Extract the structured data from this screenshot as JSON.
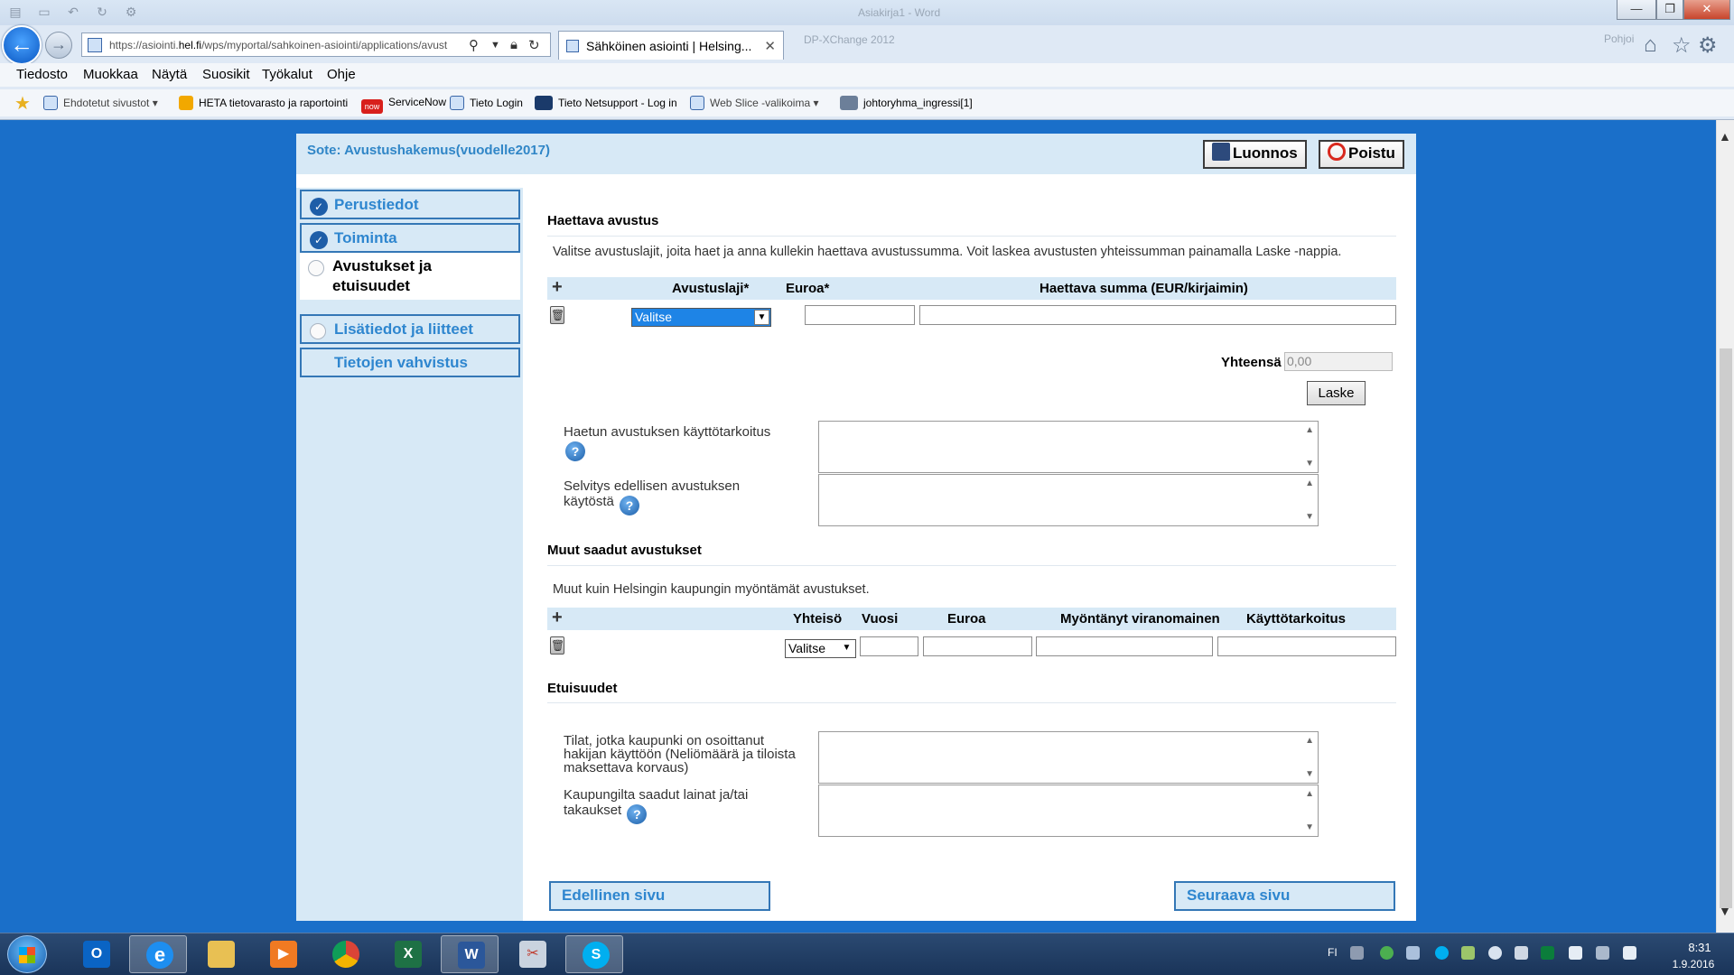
{
  "window": {
    "ghost_title": "Asiakirja1 - Word",
    "ghost_tab2": "DP-XChange 2012",
    "ghost_right": "Pohjoi",
    "min": "—",
    "max": "❐",
    "close": "✕"
  },
  "address_bar": {
    "url_prefix": "https://asiointi.",
    "url_domain": "hel.fi",
    "url_rest": "/wps/myportal/sahkoinen-asiointi/applications/avust"
  },
  "tab": {
    "title": "Sähköinen asiointi | Helsing..."
  },
  "menu": [
    "Tiedosto",
    "Muokkaa",
    "Näytä",
    "Suosikit",
    "Työkalut",
    "Ohje"
  ],
  "favorites": {
    "suggested": "Ehdotetut sivustot ▾",
    "heta": "HETA tietovarasto ja raportointi",
    "servicenow": "ServiceNow",
    "servicenow_logo": "now",
    "tieto_login": "Tieto Login",
    "tieto_netsupport": "Tieto Netsupport - Log in",
    "webslice": "Web Slice -valikoima ▾",
    "johtoryhma": "johtoryhma_ingressi[1]"
  },
  "form": {
    "title": "Sote: Avustushakemus(vuodelle2017)",
    "draft_label": "Luonnos",
    "exit_label": "Poistu",
    "sidebar": [
      {
        "label": "Perustiedot"
      },
      {
        "label": "Toiminta"
      },
      {
        "label_line1": "Avustukset ja",
        "label_line2": "etuisuudet"
      },
      {
        "label": "Lisätiedot ja liitteet"
      },
      {
        "label": "Tietojen vahvistus"
      }
    ],
    "sec1": {
      "heading": "Haettava avustus",
      "help": "Valitse avustuslajit, joita haet ja anna kullekin haettava avustussumma. Voit laskea avustusten yhteissumman painamalla Laske -nappia.",
      "col_type": "Avustuslaji*",
      "col_euro": "Euroa*",
      "col_sum": "Haettava summa (EUR/kirjaimin)",
      "select_value": "Valitse",
      "total_label": "Yhteensä",
      "total_value": "0,00",
      "calc_label": "Laske",
      "purpose_label": "Haetun avustuksen käyttötarkoitus",
      "report_label_line1": "Selvitys edellisen avustuksen",
      "report_label_line2": "käytöstä"
    },
    "sec2": {
      "heading": "Muut saadut avustukset",
      "help": "Muut kuin Helsingin kaupungin myöntämät avustukset.",
      "col_entity": "Yhteisö",
      "col_year": "Vuosi",
      "col_euro": "Euroa",
      "col_authority": "Myöntänyt viranomainen",
      "col_purpose": "Käyttötarkoitus",
      "select_value": "Valitse"
    },
    "sec3": {
      "heading": "Etuisuudet",
      "premises_label": "Tilat, jotka kaupunki on osoittanut hakijan käyttöön (Neliömäärä ja tiloista maksettava korvaus)",
      "loans_label_line1": "Kaupungilta saadut lainat ja/tai",
      "loans_label_line2": "takaukset"
    },
    "prev_page": "Edellinen sivu",
    "next_page": "Seuraava sivu"
  },
  "taskbar": {
    "lang": "FI",
    "time": "8:31",
    "date": "1.9.2016"
  }
}
